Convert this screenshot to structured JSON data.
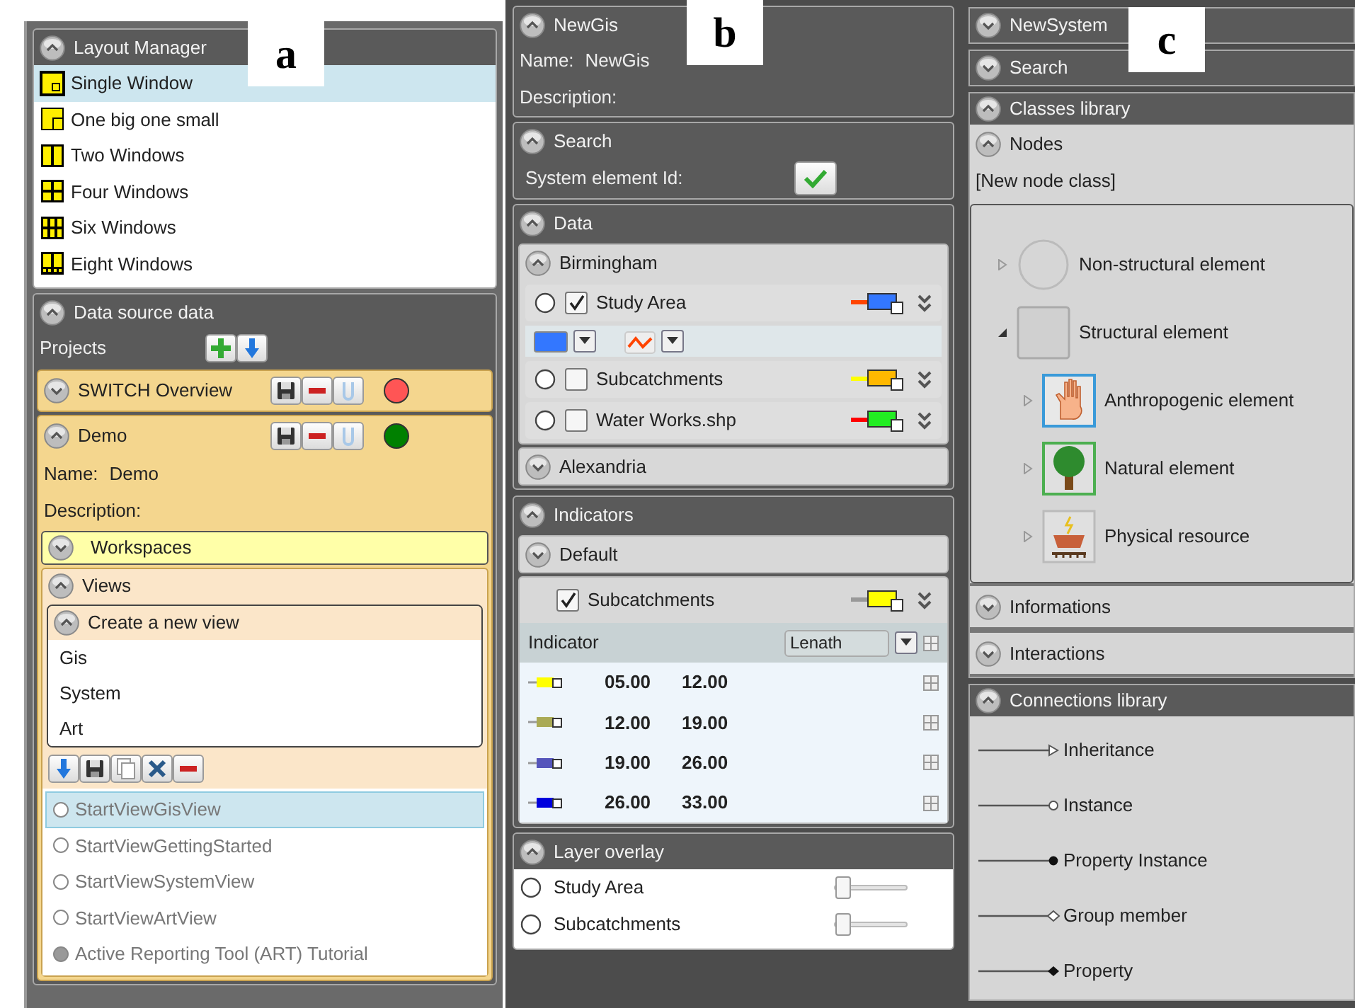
{
  "panel_labels": [
    "a",
    "b",
    "c"
  ],
  "layout_manager": {
    "title": "Layout Manager",
    "expanded": true,
    "items": [
      {
        "label": "Single Window",
        "kind": "single",
        "selected": true
      },
      {
        "label": "One big one small",
        "kind": "big-small",
        "selected": false
      },
      {
        "label": "Two Windows",
        "kind": "two",
        "selected": false
      },
      {
        "label": "Four Windows",
        "kind": "four",
        "selected": false
      },
      {
        "label": "Six Windows",
        "kind": "six",
        "selected": false
      },
      {
        "label": "Eight Windows",
        "kind": "eight",
        "selected": false
      }
    ]
  },
  "data_source": {
    "title": "Data source data",
    "expanded": true,
    "projects_label": "Projects",
    "projects": [
      {
        "title": "SWITCH Overview",
        "expanded": false,
        "color": "#ff5555"
      },
      {
        "title": "Demo",
        "expanded": true,
        "color": "#008000",
        "name_label": "Name:",
        "name_value": "Demo",
        "description_label": "Description:",
        "workspaces": {
          "title": "Workspaces",
          "expanded": false
        },
        "views": {
          "title": "Views",
          "expanded": true,
          "create": {
            "title": "Create a new view",
            "expanded": true,
            "items": [
              "Gis",
              "System",
              "Art"
            ]
          },
          "list": [
            {
              "label": "StartViewGisView",
              "selected": true,
              "checked": false
            },
            {
              "label": "StartViewGettingStarted",
              "selected": false,
              "checked": false
            },
            {
              "label": "StartViewSystemView",
              "selected": false,
              "checked": false
            },
            {
              "label": "StartViewArtView",
              "selected": false,
              "checked": false
            },
            {
              "label": "Active Reporting Tool (ART) Tutorial",
              "selected": false,
              "checked": true
            }
          ]
        }
      }
    ]
  },
  "gis": {
    "title": "NewGis",
    "expanded": true,
    "name_label": "Name:",
    "name_value": "NewGis",
    "description_label": "Description:"
  },
  "search": {
    "title": "Search",
    "expanded": true,
    "field_label": "System element Id:"
  },
  "data": {
    "title": "Data",
    "expanded": true,
    "groups": [
      {
        "title": "Birmingham",
        "expanded": true,
        "layers": [
          {
            "name": "Study Area",
            "active": false,
            "checked": true,
            "line": {
              "color": "#ff4400"
            },
            "fill": {
              "color": "#3377ff"
            },
            "expanded": true
          },
          {
            "name": "Subcatchments",
            "active": false,
            "checked": false,
            "line": {
              "color": "#ffff00"
            },
            "fill": {
              "color": "#ffb800"
            },
            "expanded": false
          },
          {
            "name": "Water Works.shp",
            "active": false,
            "checked": false,
            "line": {
              "color": "#ff0000"
            },
            "fill": {
              "color": "#22ee22"
            },
            "expanded": false
          }
        ]
      },
      {
        "title": "Alexandria",
        "expanded": false
      }
    ]
  },
  "indicators": {
    "title": "Indicators",
    "expanded": true,
    "group": {
      "title": "Default",
      "expanded": false
    },
    "layer": {
      "name": "Subcatchments",
      "checked": true,
      "fill": {
        "color": "#ffff00"
      }
    },
    "header": "Indicator",
    "attribute": "Lenath",
    "ranges": [
      {
        "color": "#ffff00",
        "from": "05.00",
        "to": "12.00"
      },
      {
        "color": "#aaaa55",
        "from": "12.00",
        "to": "19.00"
      },
      {
        "color": "#5555bb",
        "from": "19.00",
        "to": "26.00"
      },
      {
        "color": "#0000dd",
        "from": "26.00",
        "to": "33.00"
      }
    ]
  },
  "layer_overlay": {
    "title": "Layer overlay",
    "expanded": true,
    "items": [
      {
        "name": "Study Area",
        "active": false,
        "level": 0
      },
      {
        "name": "Subcatchments",
        "active": false,
        "level": 0
      }
    ]
  },
  "system_sections": [
    {
      "title": "NewSystem",
      "expanded": false
    },
    {
      "title": "Search",
      "expanded": false
    },
    {
      "title": "Classes library",
      "expanded": true,
      "subsections": [
        {
          "title": "Nodes",
          "expanded": true,
          "new_label": "[New node class]",
          "tree": [
            {
              "label": "Non-structural element",
              "kind": "circle",
              "expanded": false
            },
            {
              "label": "Structural element",
              "kind": "square",
              "expanded": true,
              "children": [
                {
                  "label": "Anthropogenic element",
                  "kind": "hand",
                  "expanded": false
                },
                {
                  "label": "Natural element",
                  "kind": "tree",
                  "expanded": false
                },
                {
                  "label": "Physical resource",
                  "kind": "resource",
                  "expanded": false
                }
              ]
            }
          ]
        },
        {
          "title": "Informations",
          "expanded": false
        },
        {
          "title": "Interactions",
          "expanded": false
        }
      ]
    },
    {
      "title": "Connections library",
      "expanded": true,
      "connections": [
        {
          "label": "Inheritance",
          "kind": "triangle"
        },
        {
          "label": "Instance",
          "kind": "circle"
        },
        {
          "label": "Property Instance",
          "kind": "dot"
        },
        {
          "label": "Group member",
          "kind": "diamond"
        },
        {
          "label": "Property",
          "kind": "filled-diamond"
        }
      ]
    }
  ]
}
